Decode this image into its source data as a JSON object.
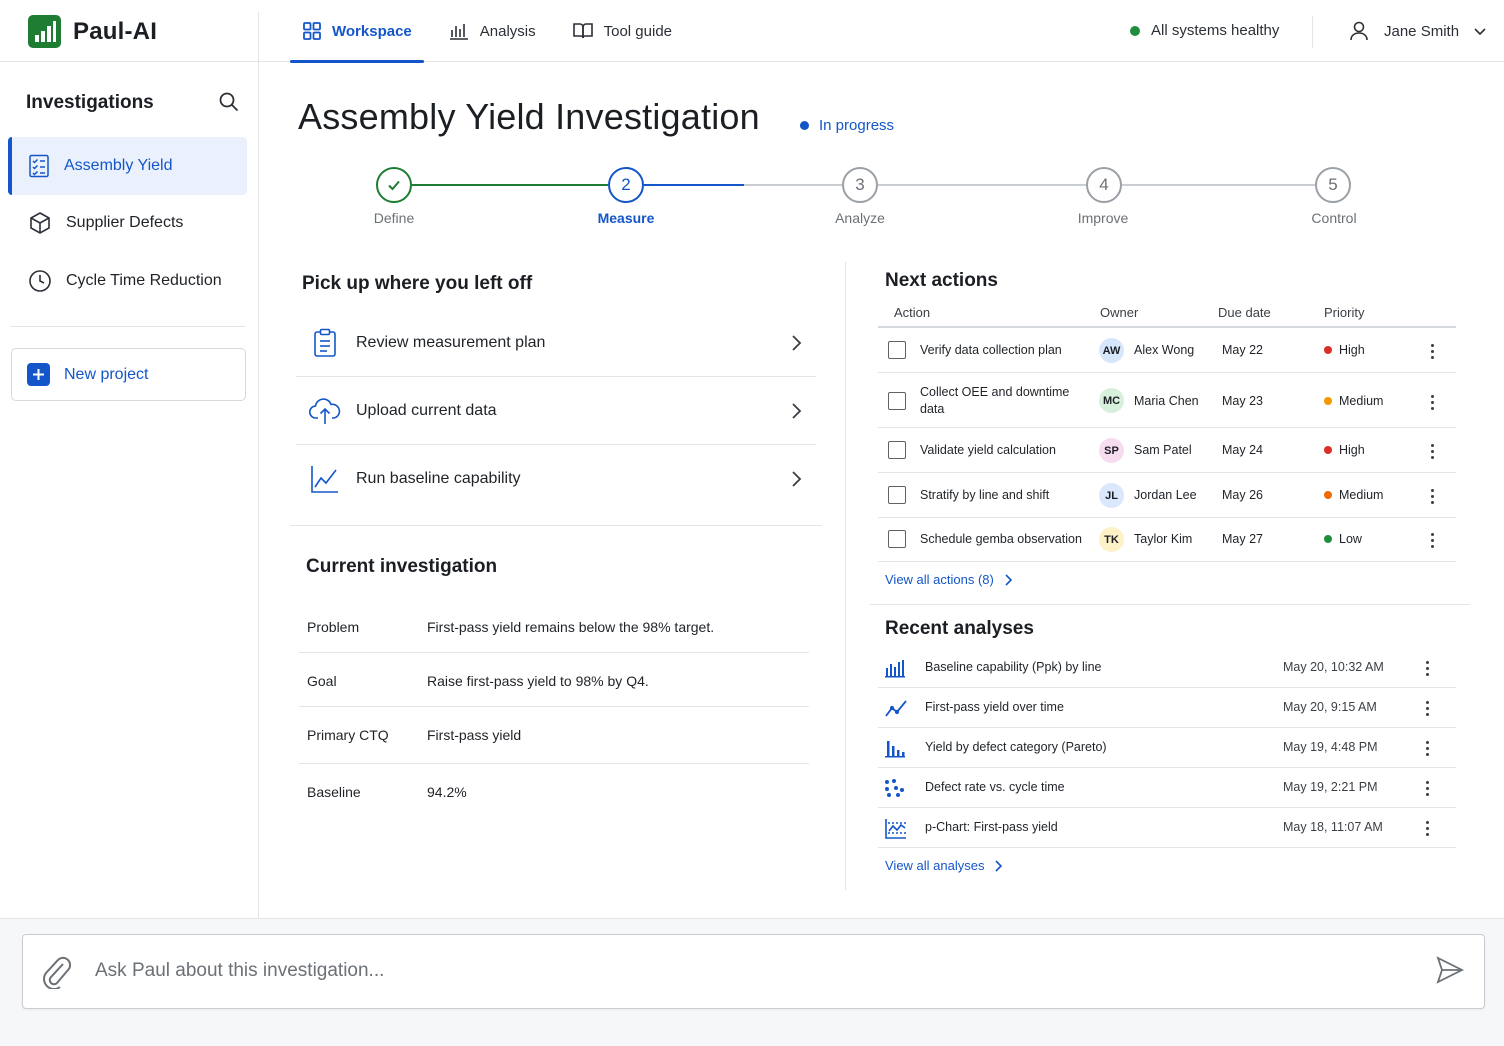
{
  "app": {
    "name": "Paul-AI"
  },
  "nav": {
    "tabs": [
      {
        "label": "Workspace",
        "icon": "grid-icon",
        "active": true
      },
      {
        "label": "Analysis",
        "icon": "bar-chart-icon",
        "active": false
      },
      {
        "label": "Tool guide",
        "icon": "book-icon",
        "active": false
      }
    ]
  },
  "system_status": {
    "label": "All systems healthy",
    "color": "#1e8e3e"
  },
  "user": {
    "name": "Jane Smith"
  },
  "sidebar": {
    "title": "Investigations",
    "items": [
      {
        "label": "Assembly Yield",
        "icon": "checklist-icon",
        "active": true
      },
      {
        "label": "Supplier Defects",
        "icon": "cube-icon",
        "active": false
      },
      {
        "label": "Cycle Time Reduction",
        "icon": "clock-icon",
        "active": false
      }
    ],
    "new_project_label": "New project"
  },
  "page": {
    "title": "Assembly Yield Investigation",
    "status": "In progress"
  },
  "stepper": {
    "steps": [
      {
        "number": "1",
        "label": "Define",
        "state": "complete"
      },
      {
        "number": "2",
        "label": "Measure",
        "state": "current"
      },
      {
        "number": "3",
        "label": "Analyze",
        "state": "upcoming"
      },
      {
        "number": "4",
        "label": "Improve",
        "state": "upcoming"
      },
      {
        "number": "5",
        "label": "Control",
        "state": "upcoming"
      }
    ]
  },
  "resume": {
    "title": "Pick up where you left off",
    "items": [
      {
        "label": "Review measurement plan",
        "icon": "clipboard-icon"
      },
      {
        "label": "Upload current data",
        "icon": "cloud-upload-icon"
      },
      {
        "label": "Run baseline capability",
        "icon": "line-chart-icon"
      }
    ]
  },
  "investigation": {
    "title": "Current investigation",
    "rows": [
      {
        "key": "Problem",
        "value": "First-pass yield remains below the 98% target."
      },
      {
        "key": "Goal",
        "value": "Raise first-pass yield to 98% by Q4."
      },
      {
        "key": "Primary CTQ",
        "value": "First-pass yield"
      },
      {
        "key": "Baseline",
        "value": "94.2%"
      }
    ]
  },
  "actions": {
    "title": "Next actions",
    "columns": [
      "Action",
      "Owner",
      "Due date",
      "Priority"
    ],
    "rows": [
      {
        "action": "Verify data collection plan",
        "initials": "AW",
        "owner": "Alex Wong",
        "avatar_color": "#d6e6fb",
        "due": "May 22",
        "priority": "High",
        "priority_color": "#d93025"
      },
      {
        "action": "Collect OEE and downtime data",
        "initials": "MC",
        "owner": "Maria Chen",
        "avatar_color": "#d7f0dc",
        "due": "May 23",
        "priority": "Medium",
        "priority_color": "#f29900"
      },
      {
        "action": "Validate yield calculation",
        "initials": "SP",
        "owner": "Sam Patel",
        "avatar_color": "#f5dcef",
        "due": "May 24",
        "priority": "High",
        "priority_color": "#d93025"
      },
      {
        "action": "Stratify by line and shift",
        "initials": "JL",
        "owner": "Jordan Lee",
        "avatar_color": "#dbe7fb",
        "due": "May 26",
        "priority": "Medium",
        "priority_color": "#f26b00"
      },
      {
        "action": "Schedule gemba observation",
        "initials": "TK",
        "owner": "Taylor Kim",
        "avatar_color": "#fdf1c8",
        "due": "May 27",
        "priority": "Low",
        "priority_color": "#1e8e3e"
      }
    ],
    "view_all": "View all actions (8)"
  },
  "analyses": {
    "title": "Recent analyses",
    "rows": [
      {
        "name": "Baseline capability (Ppk) by line",
        "time": "May 20, 10:32 AM",
        "icon": "bar-chart-icon"
      },
      {
        "name": "First-pass yield over time",
        "time": "May 20, 9:15 AM",
        "icon": "trend-line-icon"
      },
      {
        "name": "Yield by defect category (Pareto)",
        "time": "May 19, 4:48 PM",
        "icon": "pareto-icon"
      },
      {
        "name": "Defect rate vs. cycle time",
        "time": "May 19, 2:21 PM",
        "icon": "scatter-icon"
      },
      {
        "name": "p-Chart: First-pass yield",
        "time": "May 18, 11:07 AM",
        "icon": "control-chart-icon"
      }
    ],
    "view_all": "View all analyses"
  },
  "chat": {
    "placeholder": "Ask Paul about this investigation..."
  },
  "colors": {
    "accent": "#1456c9",
    "success": "#1e7d32"
  }
}
